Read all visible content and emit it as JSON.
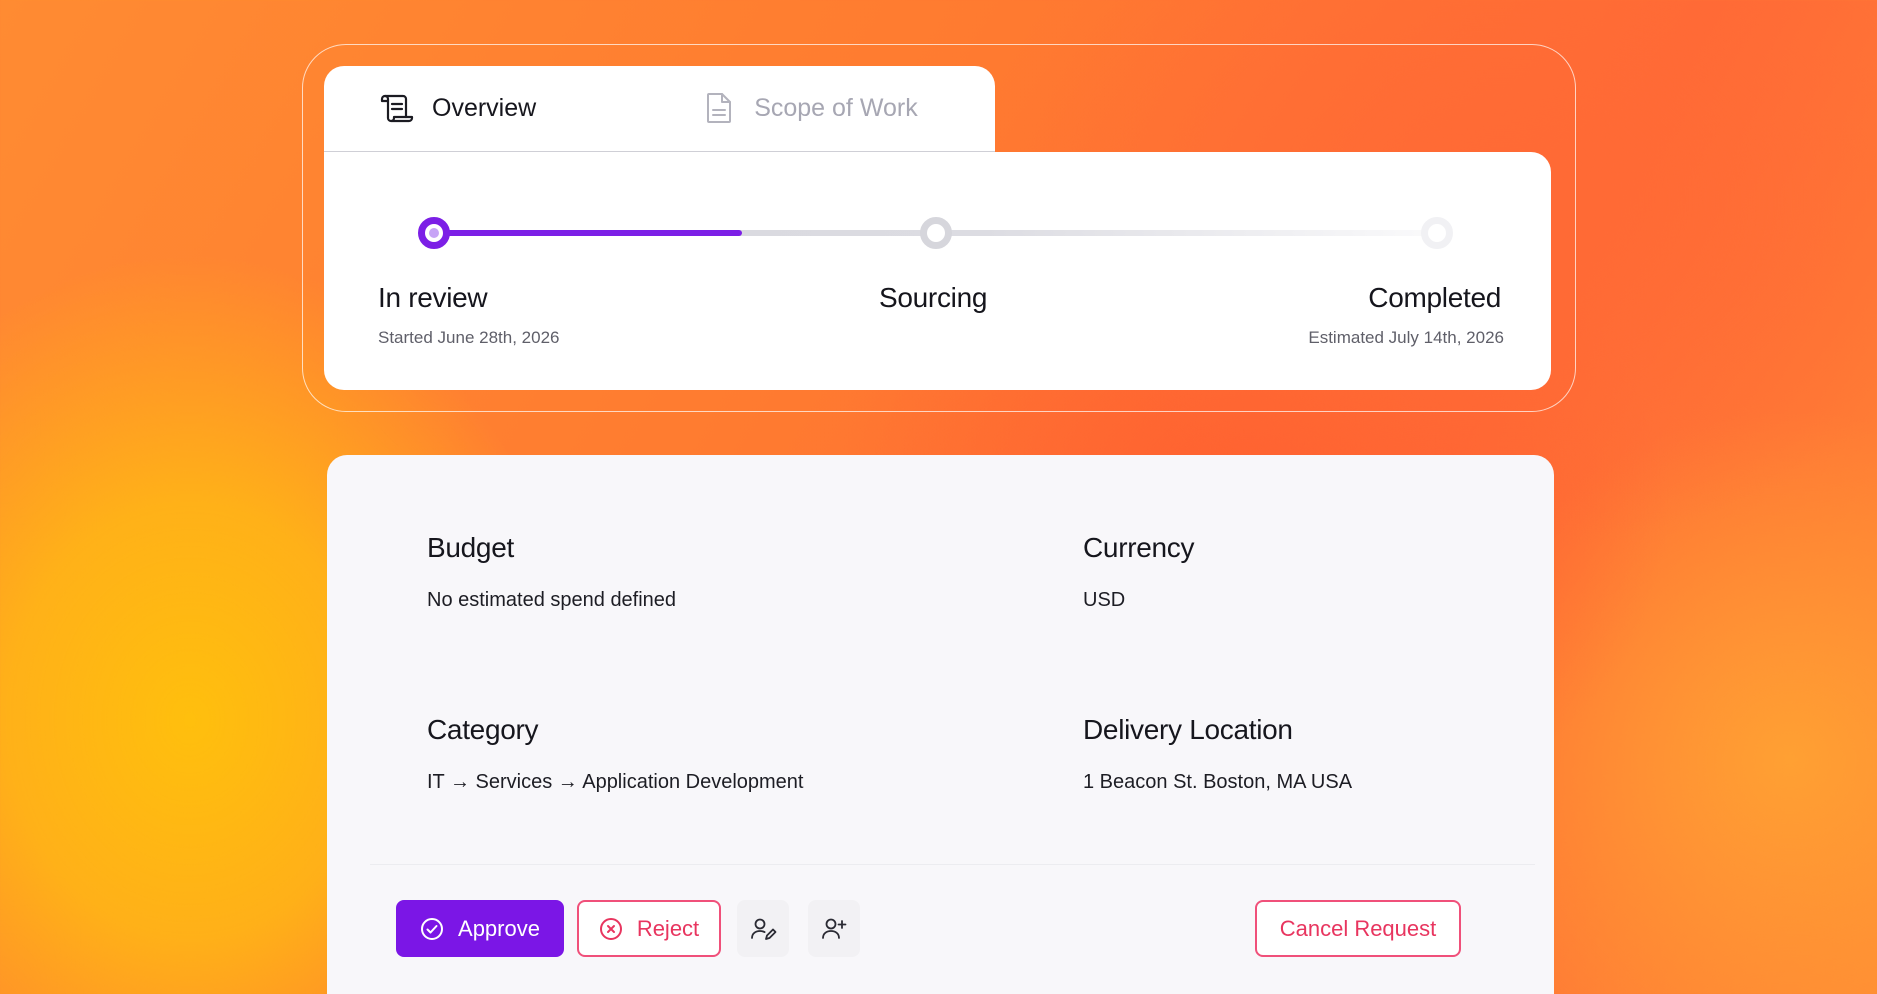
{
  "tabs": [
    {
      "label": "Overview",
      "icon": "scroll-icon",
      "active": true
    },
    {
      "label": "Scope of Work",
      "icon": "document-icon",
      "active": false
    }
  ],
  "progress": {
    "stages": [
      {
        "title": "In review",
        "subtitle": "Started June 28th, 2026",
        "status": "active"
      },
      {
        "title": "Sourcing",
        "subtitle": "",
        "status": "upcoming"
      },
      {
        "title": "Completed",
        "subtitle": "Estimated July 14th, 2026",
        "status": "upcoming"
      }
    ],
    "fill_fraction": 0.31
  },
  "details": {
    "budget": {
      "label": "Budget",
      "value": "No estimated spend defined"
    },
    "currency": {
      "label": "Currency",
      "value": "USD"
    },
    "category": {
      "label": "Category",
      "value": "IT → Services → Application Development"
    },
    "delivery_location": {
      "label": "Delivery Location",
      "value": "1 Beacon St. Boston, MA USA"
    }
  },
  "actions": {
    "approve_label": "Approve",
    "reject_label": "Reject",
    "cancel_label": "Cancel Request",
    "icons": [
      "check-circle-icon",
      "x-circle-icon",
      "user-edit-icon",
      "user-add-icon"
    ]
  },
  "colors": {
    "accent": "#7b16e6",
    "danger": "#e8355f",
    "background_start": "#ffbf0d",
    "background_end": "#ff6a35"
  }
}
